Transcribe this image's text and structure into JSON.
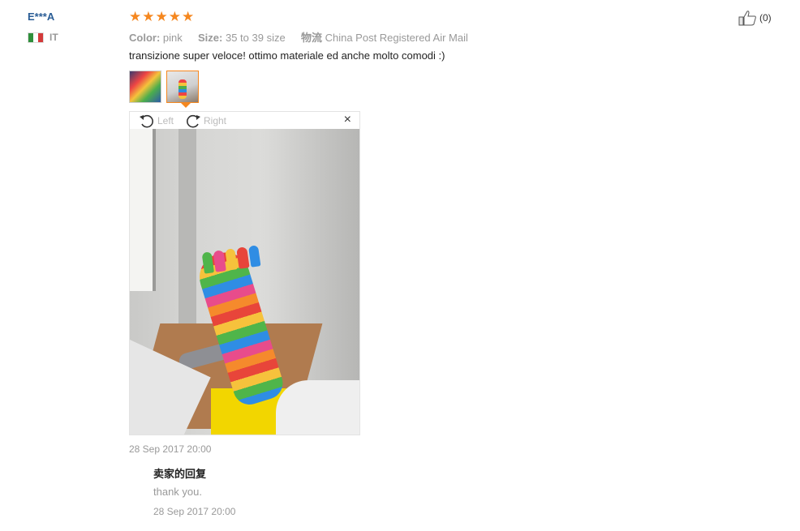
{
  "review": {
    "buyer_name": "E***A",
    "country_code": "IT",
    "flag_colors": [
      "#2f8f3b",
      "#ffffff",
      "#d33a3a"
    ],
    "rating": 5,
    "stars": [
      "★",
      "★",
      "★",
      "★",
      "★"
    ],
    "star_color": "#f5871f",
    "color_label": "Color:",
    "color_value": "pink",
    "size_label": "Size:",
    "size_value": "35 to 39 size",
    "shipping_label": "物流",
    "shipping_value": "China Post Registered Air Mail",
    "text": "transizione super veloce! ottimo materiale ed anche molto comodi :)",
    "date": "28 Sep 2017 20:00",
    "helpful_count": "(0)"
  },
  "viewer": {
    "rotate_left_label": "Left",
    "rotate_right_label": "Right",
    "close_symbol": "×"
  },
  "reply": {
    "title": "卖家的回复",
    "text": "thank you.",
    "date": "28 Sep 2017 20:00"
  },
  "icons": {
    "rotate_left": "rotate-left-icon",
    "rotate_right": "rotate-right-icon",
    "thumbs_up": "thumbs-up-icon"
  }
}
